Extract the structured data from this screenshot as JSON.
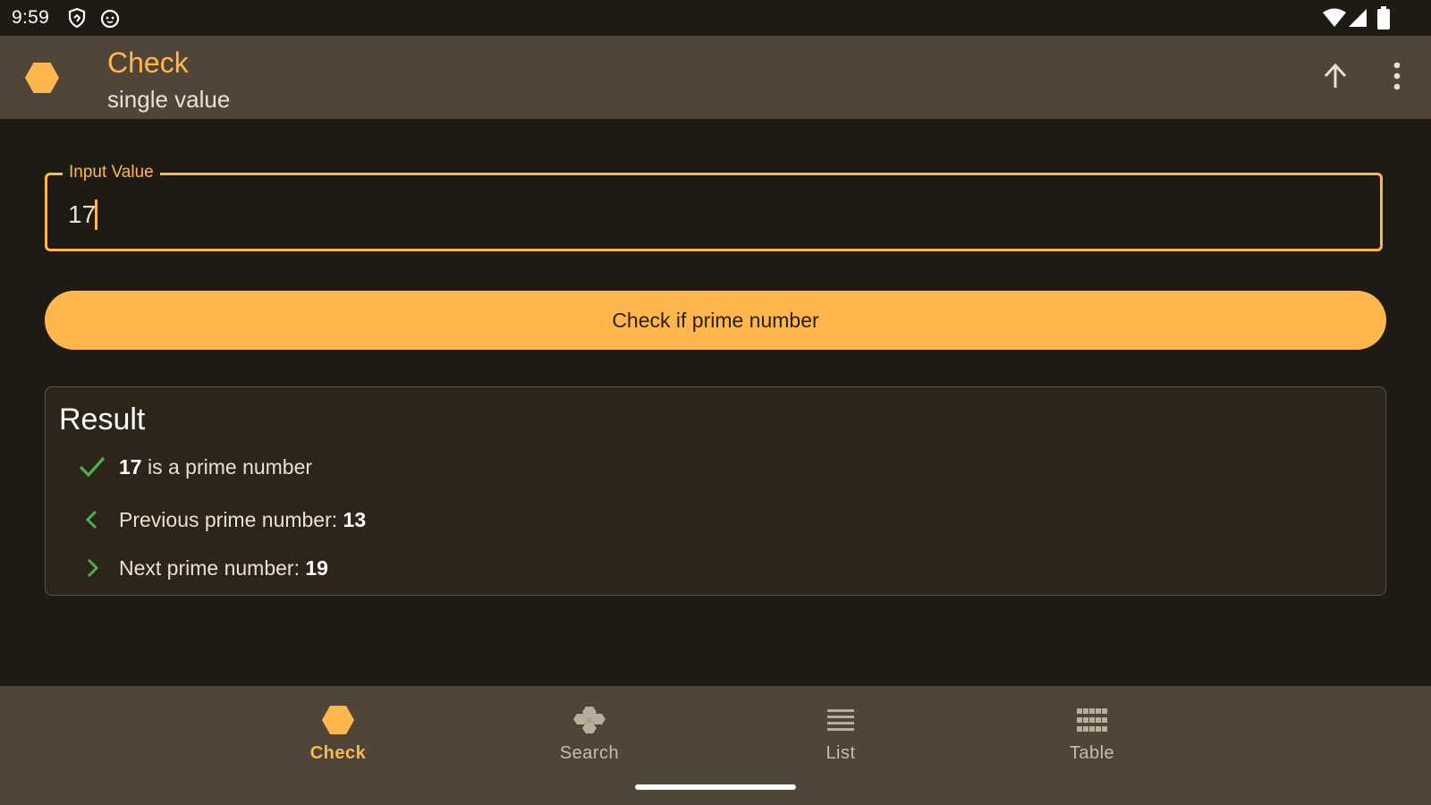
{
  "status_bar": {
    "time": "9:59",
    "icons": [
      "shield-icon",
      "cat-face-icon",
      "wifi-icon",
      "cellular-signal-icon",
      "battery-icon"
    ]
  },
  "app_bar": {
    "title": "Check",
    "subtitle": "single value",
    "logo_icon": "hexagon-icon",
    "actions": [
      "arrow-up-icon",
      "more-vertical-icon"
    ]
  },
  "input": {
    "label": "Input Value",
    "value": "17"
  },
  "check_button": {
    "label": "Check if prime number"
  },
  "result": {
    "title": "Result",
    "rows": [
      {
        "icon": "check-icon",
        "bold": "17",
        "text": " is a prime number"
      },
      {
        "icon": "chevron-left-icon",
        "text": "Previous prime number: ",
        "bold": "13"
      },
      {
        "icon": "chevron-right-icon",
        "text": "Next prime number: ",
        "bold": "19"
      }
    ]
  },
  "bottom_nav": {
    "items": [
      {
        "label": "Check",
        "icon": "hexagon-icon",
        "active": true
      },
      {
        "label": "Search",
        "icon": "cluster-icon",
        "active": false
      },
      {
        "label": "List",
        "icon": "list-icon",
        "active": false
      },
      {
        "label": "Table",
        "icon": "grid-icon",
        "active": false
      }
    ]
  },
  "colors": {
    "accent": "#ffb74d",
    "background": "#1e1b15",
    "surface": "#4f4539",
    "card": "#2d241a",
    "success": "#4caf50"
  }
}
